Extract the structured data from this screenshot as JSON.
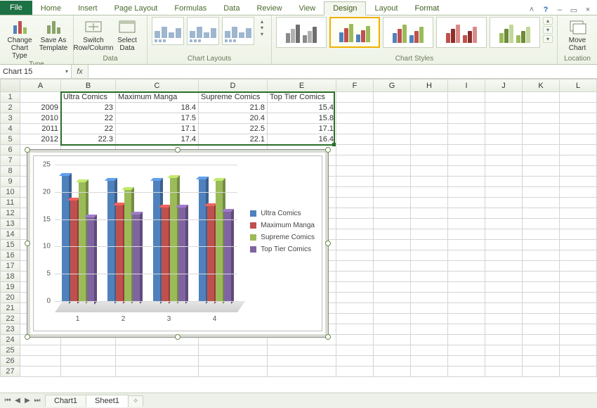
{
  "tabs": {
    "file": "File",
    "home": "Home",
    "insert": "Insert",
    "page_layout": "Page Layout",
    "formulas": "Formulas",
    "data": "Data",
    "review": "Review",
    "view": "View",
    "design": "Design",
    "layout": "Layout",
    "format": "Format"
  },
  "ribbon": {
    "type": {
      "label": "Type",
      "change": "Change\nChart Type",
      "saveas": "Save As\nTemplate"
    },
    "data": {
      "label": "Data",
      "switch": "Switch\nRow/Column",
      "select": "Select\nData"
    },
    "layouts": {
      "label": "Chart Layouts"
    },
    "styles": {
      "label": "Chart Styles"
    },
    "location": {
      "label": "Location",
      "move": "Move\nChart"
    }
  },
  "namebox": "Chart 15",
  "fx": "fx",
  "columns": [
    "A",
    "B",
    "C",
    "D",
    "E",
    "F",
    "G",
    "H",
    "I",
    "J",
    "K",
    "L"
  ],
  "headers": {
    "B": "Ultra Comics",
    "C": "Maximum Manga",
    "D": "Supreme Comics",
    "E": "Top Tier Comics"
  },
  "rows": [
    {
      "A": "2009",
      "B": "23",
      "C": "18.4",
      "D": "21.8",
      "E": "15.4"
    },
    {
      "A": "2010",
      "B": "22",
      "C": "17.5",
      "D": "20.4",
      "E": "15.8"
    },
    {
      "A": "2011",
      "B": "22",
      "C": "17.1",
      "D": "22.5",
      "E": "17.1"
    },
    {
      "A": "2012",
      "B": "22.3",
      "C": "17.4",
      "D": "22.1",
      "E": "16.4"
    }
  ],
  "blank_rows": 22,
  "sheet_tabs": {
    "chart": "Chart1",
    "sheet": "Sheet1"
  },
  "chart_data": {
    "type": "bar",
    "categories": [
      "1",
      "2",
      "3",
      "4"
    ],
    "series": [
      {
        "name": "Ultra Comics",
        "color": "#4f81bd",
        "values": [
          23,
          22,
          22,
          22.3
        ]
      },
      {
        "name": "Maximum Manga",
        "color": "#c0504d",
        "values": [
          18.4,
          17.5,
          17.1,
          17.4
        ]
      },
      {
        "name": "Supreme Comics",
        "color": "#9bbb59",
        "values": [
          21.8,
          20.4,
          22.5,
          22.1
        ]
      },
      {
        "name": "Top Tier Comics",
        "color": "#8064a2",
        "values": [
          15.4,
          15.8,
          17.1,
          16.4
        ]
      }
    ],
    "ylim": [
      0,
      25
    ],
    "yticks": [
      0,
      5,
      10,
      15,
      20,
      25
    ],
    "title": "",
    "xlabel": "",
    "ylabel": ""
  },
  "style_palettes": [
    [
      "#8a8a8a",
      "#b0b0b0",
      "#6e6e6e"
    ],
    [
      "#4f81bd",
      "#c0504d",
      "#9bbb59"
    ],
    [
      "#4f81bd",
      "#c0504d",
      "#9bbb59"
    ],
    [
      "#c0504d",
      "#8a2f2c",
      "#d98b89"
    ],
    [
      "#9bbb59",
      "#6e8a3b",
      "#c3d69b"
    ]
  ],
  "style_selected": 1
}
